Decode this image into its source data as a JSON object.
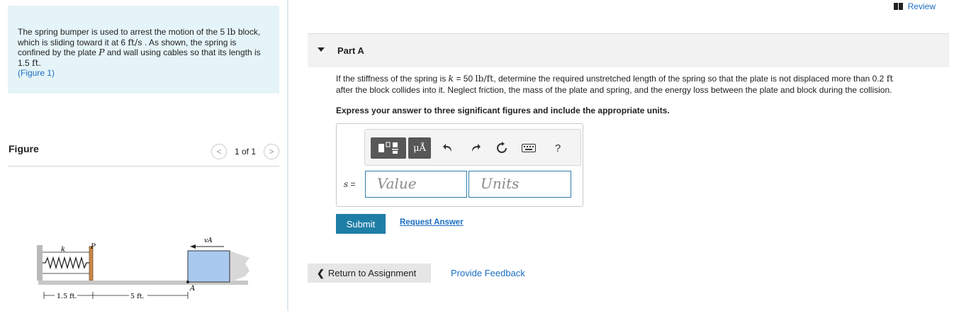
{
  "problem": {
    "t1": "The spring bumper is used to arrest the motion of the 5 ",
    "u_lb": "lb",
    "t2": "block, which is sliding toward it at 6 ",
    "u_fts": "ft/s",
    "t3": " . As shown, the spring is confined by the plate ",
    "var_P": "P",
    "t4": " and wall using cables so that its length is 1.5 ",
    "u_ft": "ft",
    "t5": ".",
    "figure_link": "(Figure 1)"
  },
  "figure": {
    "title": "Figure",
    "pager_text": "1 of 1",
    "prev_glyph": "<",
    "next_glyph": ">",
    "labels": {
      "k": "k",
      "P": "P",
      "vA": "vA",
      "A": "A",
      "len1": "1.5 ft.",
      "len2": "5 ft."
    }
  },
  "review": {
    "label": "Review",
    "icon": "book-icon"
  },
  "part": {
    "label": "Part A"
  },
  "question": {
    "q1": "If the stiffness of the spring is ",
    "var_k": "k",
    "q2": " = 50 ",
    "u_lbft": "lb/ft",
    "q3": ", determine the required unstretched length of the spring so that the plate is not displaced more than 0.2 ",
    "u_ft": "ft",
    "q4": "after the block collides into it. Neglect friction, the mass of the plate and spring, and the energy loss between the plate and block during the collision."
  },
  "instruction": "Express your answer to three significant figures and include the appropriate units.",
  "toolbar": {
    "templates_icon": "templates-icon",
    "units_label": "μÅ",
    "undo_icon": "undo-icon",
    "redo_icon": "redo-icon",
    "reset_icon": "reset-icon",
    "keyboard_icon": "keyboard-icon",
    "help_label": "?"
  },
  "answer": {
    "var": "s",
    "equals": " =",
    "value_placeholder": "Value",
    "units_placeholder": "Units"
  },
  "actions": {
    "submit": "Submit",
    "request_answer": "Request Answer",
    "return": "Return to Assignment",
    "return_glyph": "❮",
    "feedback": "Provide Feedback"
  },
  "colors": {
    "accent": "#1f7ea6",
    "link": "#1b6ec2",
    "problem_bg": "#e5f4f8",
    "block_fill": "#a9c9ee"
  }
}
